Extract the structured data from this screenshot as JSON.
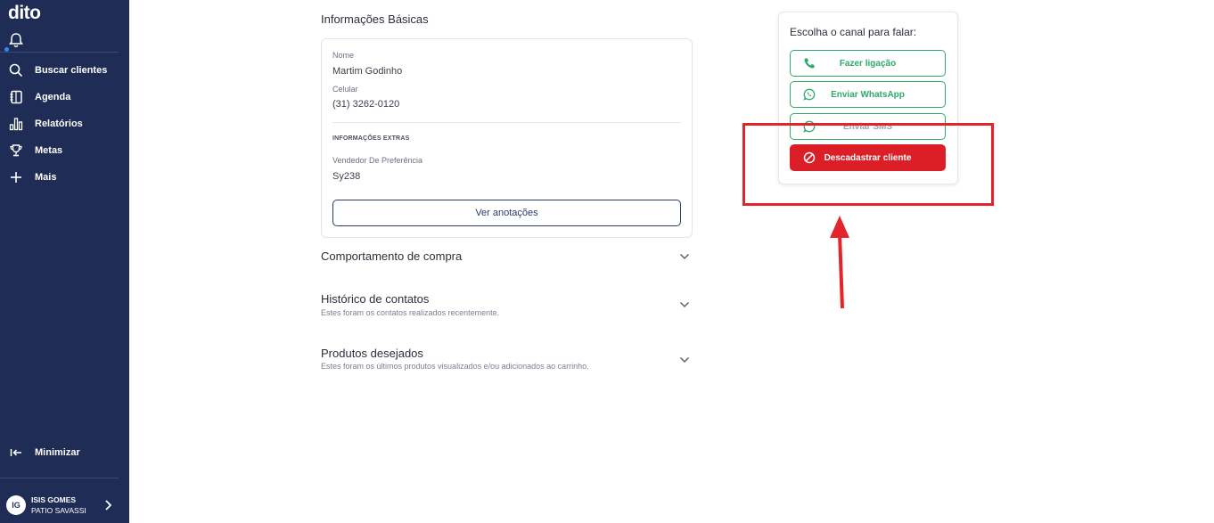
{
  "sidebar": {
    "logo": "dito",
    "items": [
      {
        "label": "Buscar clientes",
        "icon": "search-icon"
      },
      {
        "label": "Agenda",
        "icon": "agenda-icon"
      },
      {
        "label": "Relatórios",
        "icon": "chart-icon"
      },
      {
        "label": "Metas",
        "icon": "trophy-icon"
      },
      {
        "label": "Mais",
        "icon": "plus-icon"
      }
    ],
    "minimize_label": "Minimizar",
    "user": {
      "initials": "IG",
      "name": "ISIS GOMES",
      "store": "PATIO SAVASSI"
    }
  },
  "basic_info": {
    "title": "Informações Básicas",
    "name_label": "Nome",
    "name_value": "Martim Godinho",
    "phone_label": "Celular",
    "phone_value": "(31) 3262-0120",
    "extra_label": "INFORMAÇÕES EXTRAS",
    "seller_label": "Vendedor De Preferência",
    "seller_value": "Sy238",
    "notes_button": "Ver anotações"
  },
  "accordions": [
    {
      "title": "Comportamento de compra",
      "subtitle": ""
    },
    {
      "title": "Histórico de contatos",
      "subtitle": "Estes foram os contatos realizados recentemente."
    },
    {
      "title": "Produtos desejados",
      "subtitle": "Estes foram os últimos produtos visualizados e/ou adicionados ao carrinho."
    }
  ],
  "channel": {
    "title": "Escolha o canal para falar:",
    "call": "Fazer ligação",
    "whatsapp": "Enviar WhatsApp",
    "sms": "Enviar SMS",
    "unsubscribe": "Descadastrar cliente"
  },
  "colors": {
    "sidebar_bg": "#1f2c55",
    "accent_green": "#2fa96a",
    "danger_red": "#dc1f26",
    "annotation_red": "#e3242b",
    "primary_navy": "#2d3a6b"
  }
}
